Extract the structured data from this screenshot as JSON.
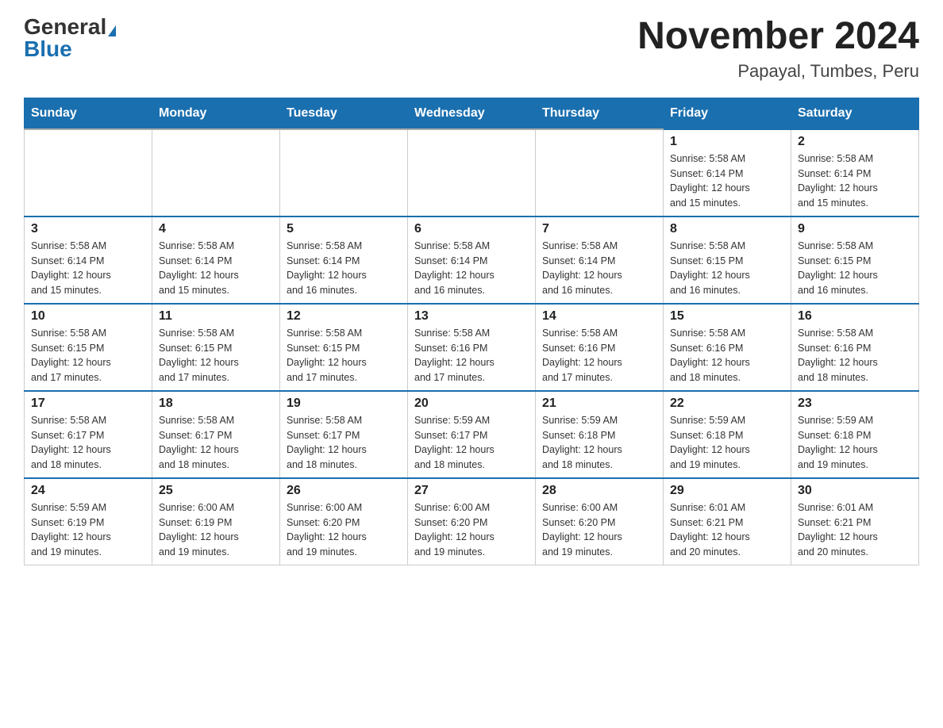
{
  "logo": {
    "general": "General",
    "blue": "Blue"
  },
  "title": "November 2024",
  "subtitle": "Papayal, Tumbes, Peru",
  "days_of_week": [
    "Sunday",
    "Monday",
    "Tuesday",
    "Wednesday",
    "Thursday",
    "Friday",
    "Saturday"
  ],
  "weeks": [
    [
      {
        "day": "",
        "info": ""
      },
      {
        "day": "",
        "info": ""
      },
      {
        "day": "",
        "info": ""
      },
      {
        "day": "",
        "info": ""
      },
      {
        "day": "",
        "info": ""
      },
      {
        "day": "1",
        "info": "Sunrise: 5:58 AM\nSunset: 6:14 PM\nDaylight: 12 hours\nand 15 minutes."
      },
      {
        "day": "2",
        "info": "Sunrise: 5:58 AM\nSunset: 6:14 PM\nDaylight: 12 hours\nand 15 minutes."
      }
    ],
    [
      {
        "day": "3",
        "info": "Sunrise: 5:58 AM\nSunset: 6:14 PM\nDaylight: 12 hours\nand 15 minutes."
      },
      {
        "day": "4",
        "info": "Sunrise: 5:58 AM\nSunset: 6:14 PM\nDaylight: 12 hours\nand 15 minutes."
      },
      {
        "day": "5",
        "info": "Sunrise: 5:58 AM\nSunset: 6:14 PM\nDaylight: 12 hours\nand 16 minutes."
      },
      {
        "day": "6",
        "info": "Sunrise: 5:58 AM\nSunset: 6:14 PM\nDaylight: 12 hours\nand 16 minutes."
      },
      {
        "day": "7",
        "info": "Sunrise: 5:58 AM\nSunset: 6:14 PM\nDaylight: 12 hours\nand 16 minutes."
      },
      {
        "day": "8",
        "info": "Sunrise: 5:58 AM\nSunset: 6:15 PM\nDaylight: 12 hours\nand 16 minutes."
      },
      {
        "day": "9",
        "info": "Sunrise: 5:58 AM\nSunset: 6:15 PM\nDaylight: 12 hours\nand 16 minutes."
      }
    ],
    [
      {
        "day": "10",
        "info": "Sunrise: 5:58 AM\nSunset: 6:15 PM\nDaylight: 12 hours\nand 17 minutes."
      },
      {
        "day": "11",
        "info": "Sunrise: 5:58 AM\nSunset: 6:15 PM\nDaylight: 12 hours\nand 17 minutes."
      },
      {
        "day": "12",
        "info": "Sunrise: 5:58 AM\nSunset: 6:15 PM\nDaylight: 12 hours\nand 17 minutes."
      },
      {
        "day": "13",
        "info": "Sunrise: 5:58 AM\nSunset: 6:16 PM\nDaylight: 12 hours\nand 17 minutes."
      },
      {
        "day": "14",
        "info": "Sunrise: 5:58 AM\nSunset: 6:16 PM\nDaylight: 12 hours\nand 17 minutes."
      },
      {
        "day": "15",
        "info": "Sunrise: 5:58 AM\nSunset: 6:16 PM\nDaylight: 12 hours\nand 18 minutes."
      },
      {
        "day": "16",
        "info": "Sunrise: 5:58 AM\nSunset: 6:16 PM\nDaylight: 12 hours\nand 18 minutes."
      }
    ],
    [
      {
        "day": "17",
        "info": "Sunrise: 5:58 AM\nSunset: 6:17 PM\nDaylight: 12 hours\nand 18 minutes."
      },
      {
        "day": "18",
        "info": "Sunrise: 5:58 AM\nSunset: 6:17 PM\nDaylight: 12 hours\nand 18 minutes."
      },
      {
        "day": "19",
        "info": "Sunrise: 5:58 AM\nSunset: 6:17 PM\nDaylight: 12 hours\nand 18 minutes."
      },
      {
        "day": "20",
        "info": "Sunrise: 5:59 AM\nSunset: 6:17 PM\nDaylight: 12 hours\nand 18 minutes."
      },
      {
        "day": "21",
        "info": "Sunrise: 5:59 AM\nSunset: 6:18 PM\nDaylight: 12 hours\nand 18 minutes."
      },
      {
        "day": "22",
        "info": "Sunrise: 5:59 AM\nSunset: 6:18 PM\nDaylight: 12 hours\nand 19 minutes."
      },
      {
        "day": "23",
        "info": "Sunrise: 5:59 AM\nSunset: 6:18 PM\nDaylight: 12 hours\nand 19 minutes."
      }
    ],
    [
      {
        "day": "24",
        "info": "Sunrise: 5:59 AM\nSunset: 6:19 PM\nDaylight: 12 hours\nand 19 minutes."
      },
      {
        "day": "25",
        "info": "Sunrise: 6:00 AM\nSunset: 6:19 PM\nDaylight: 12 hours\nand 19 minutes."
      },
      {
        "day": "26",
        "info": "Sunrise: 6:00 AM\nSunset: 6:20 PM\nDaylight: 12 hours\nand 19 minutes."
      },
      {
        "day": "27",
        "info": "Sunrise: 6:00 AM\nSunset: 6:20 PM\nDaylight: 12 hours\nand 19 minutes."
      },
      {
        "day": "28",
        "info": "Sunrise: 6:00 AM\nSunset: 6:20 PM\nDaylight: 12 hours\nand 19 minutes."
      },
      {
        "day": "29",
        "info": "Sunrise: 6:01 AM\nSunset: 6:21 PM\nDaylight: 12 hours\nand 20 minutes."
      },
      {
        "day": "30",
        "info": "Sunrise: 6:01 AM\nSunset: 6:21 PM\nDaylight: 12 hours\nand 20 minutes."
      }
    ]
  ]
}
